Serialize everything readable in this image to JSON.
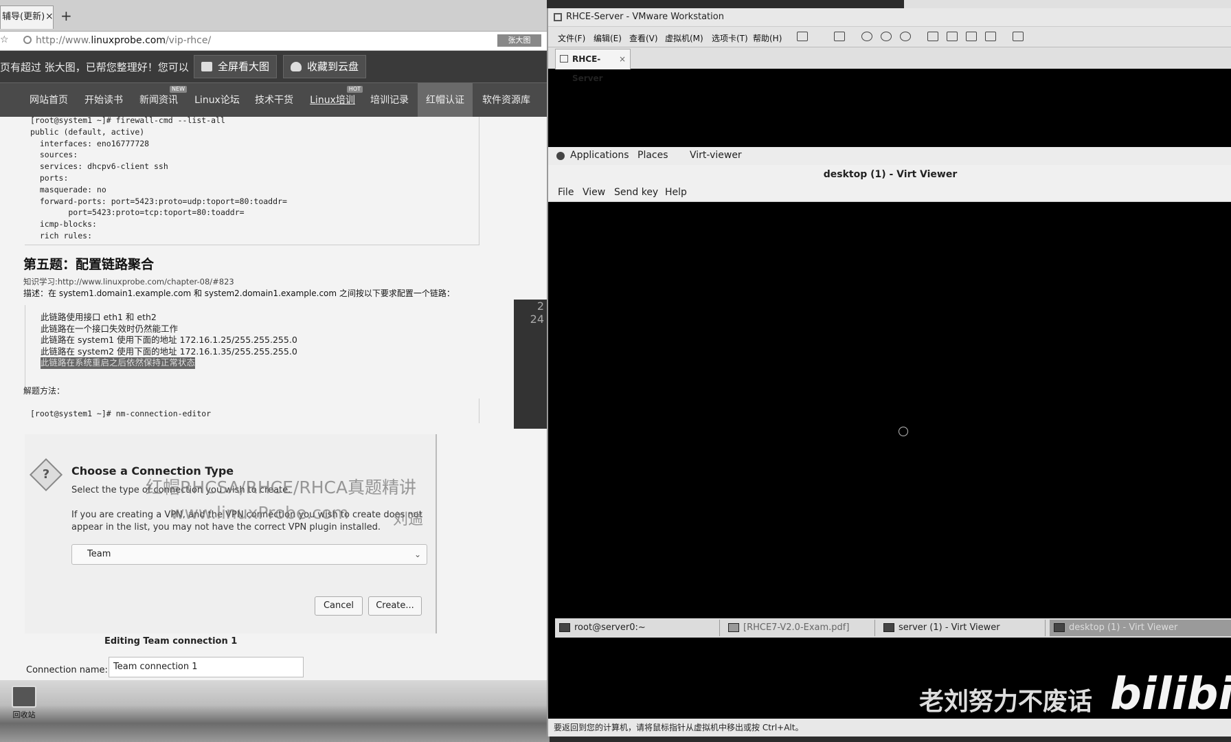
{
  "browser": {
    "tab_label": "辅导(更新)",
    "tab_close": "×",
    "new_tab": "+",
    "url_prefix": "http://www.",
    "url_domain": "linuxprobe.com",
    "url_path": "/vip-rhce/",
    "addr_chip": "张大图",
    "notice_text": "页有超过 张大图，已帮您整理好！您可以",
    "fullscreen_label": "全屏看大图",
    "save_cloud_label": "收藏到云盘"
  },
  "site_nav": [
    {
      "label": "网站首页",
      "badge": ""
    },
    {
      "label": "开始读书",
      "badge": ""
    },
    {
      "label": "新闻资讯",
      "badge": "NEW"
    },
    {
      "label": "Linux论坛",
      "badge": ""
    },
    {
      "label": "技术干货",
      "badge": ""
    },
    {
      "label": "Linux培训",
      "badge": "HOT"
    },
    {
      "label": "培训记录",
      "badge": ""
    },
    {
      "label": "红帽认证",
      "badge": ""
    },
    {
      "label": "软件资源库",
      "badge": ""
    }
  ],
  "article": {
    "code1": "[root@system1 ~]# firewall-cmd --list-all\npublic (default, active)\n  interfaces: eno16777728\n  sources:\n  services: dhcpv6-client ssh\n  ports:\n  masquerade: no\n  forward-ports: port=5423:proto=udp:toport=80:toaddr=\n        port=5423:proto=tcp:toport=80:toaddr=\n  icmp-blocks:\n  rich rules:",
    "heading": "第五题：配置链路聚合",
    "study_link": "知识学习:http://www.linuxprobe.com/chapter-08/#823",
    "description": "描述：在 system1.domain1.example.com 和 system2.domain1.example.com 之间按以下要求配置一个链路：",
    "requirements": [
      "此链路使用接口 eth1 和 eth2",
      "此链路在一个接口失效时仍然能工作",
      "此链路在 system1 使用下面的地址 172.16.1.25/255.255.255.0",
      "此链路在 system2 使用下面的地址 172.16.1.35/255.255.255.0",
      "此链路在系统重启之后依然保持正常状态"
    ],
    "method_label": "解题方法：",
    "code2": "[root@system1 ~]# nm-connection-editor"
  },
  "dialog": {
    "title": "Choose a Connection Type",
    "subtitle": "Select the type of connection you wish to create.",
    "vpn_line1": "If you are creating a VPN, and the VPN connection you wish to create does not",
    "vpn_line2": "appear in the list, you may not have the correct VPN plugin installed.",
    "selected_type": "Team",
    "chevron": "⌄",
    "cancel_label": "Cancel",
    "create_label": "Create..."
  },
  "watermark": {
    "line1": "红帽RHCSA/RHCE/RHCA真题精讲",
    "line2": "www.linuxProbe.com",
    "author": "刘遄"
  },
  "editing": {
    "title": "Editing Team connection 1",
    "name_label": "Connection name:",
    "name_value": "Team connection 1"
  },
  "side_widget": {
    "num1": "2",
    "num2": "24"
  },
  "desktop": {
    "icon_label": "回收站"
  },
  "vmware": {
    "window_title": "RHCE-Server - VMware Workstation",
    "menus": [
      "文件(F)",
      "编辑(E)",
      "查看(V)",
      "虚拟机(M)",
      "选项卡(T)",
      "帮助(H)"
    ],
    "tab_label": "RHCE-Server",
    "tab_close": "×",
    "status_text": "要返回到您的计算机，请将鼠标指针从虚拟机中移出或按 Ctrl+Alt。"
  },
  "guest": {
    "panel_items": [
      "Applications",
      "Places",
      "Virt-viewer"
    ],
    "viewer_title": "desktop (1) - Virt Viewer",
    "viewer_menus": [
      "File",
      "View",
      "Send key",
      "Help"
    ],
    "tasks": [
      {
        "label": "root@server0:~",
        "active": false
      },
      {
        "label": "[RHCE7-V2.0-Exam.pdf]",
        "active": false
      },
      {
        "label": "server (1) - Virt Viewer",
        "active": false
      },
      {
        "label": "desktop (1) - Virt Viewer",
        "active": true
      }
    ]
  },
  "overlay": {
    "slogan": "老刘努力不废话",
    "logo": "bilibili"
  }
}
